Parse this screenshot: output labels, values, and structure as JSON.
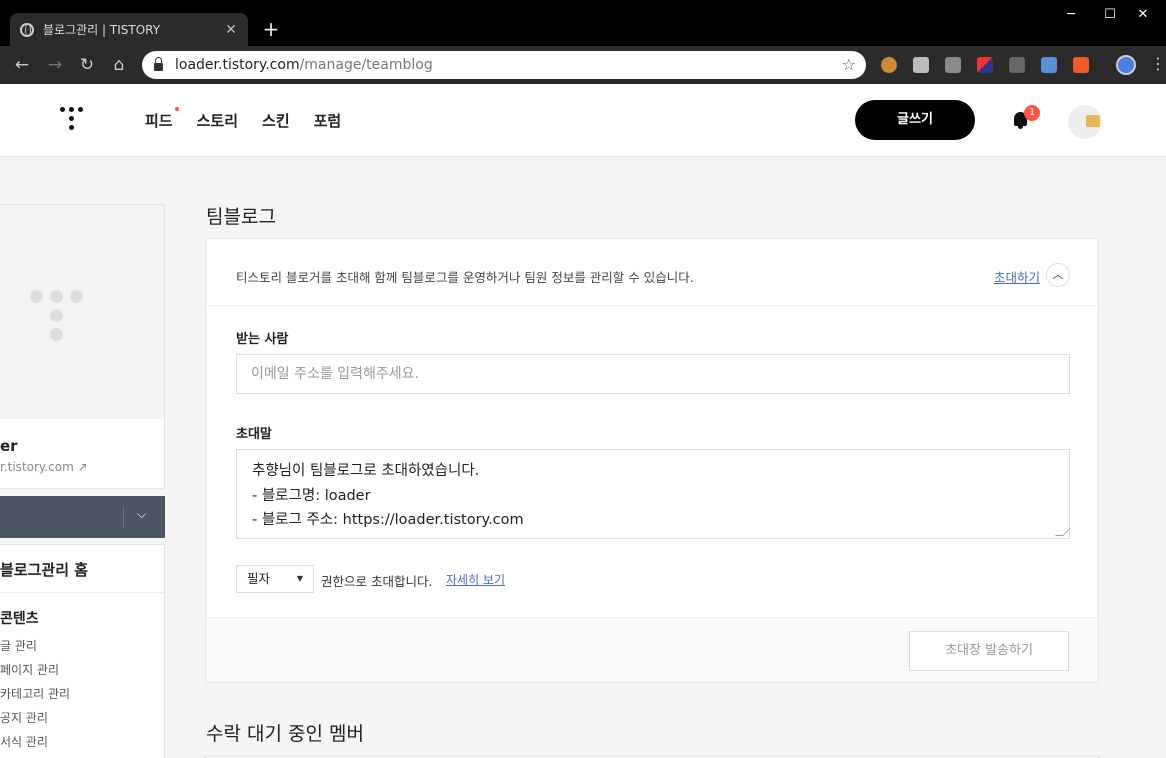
{
  "browser": {
    "tab_title": "블로그관리 | TISTORY",
    "new_tab": "+",
    "window_controls": {
      "minimize": "─",
      "maximize": "☐",
      "close": "✕"
    },
    "url_host": "loader.tistory.com",
    "url_path": "/manage/teamblog"
  },
  "header": {
    "nav": [
      "피드",
      "스토리",
      "스킨",
      "포럼"
    ],
    "write_button": "글쓰기",
    "notification_count": "1"
  },
  "sidebar": {
    "blog_name": "er",
    "blog_url": "r.tistory.com",
    "home": "블로그관리 홈",
    "section": "콘텐츠",
    "items": [
      "글 관리",
      "페이지 관리",
      "카테고리 관리",
      "공지 관리",
      "서식 관리"
    ]
  },
  "main": {
    "title": "팀블로그",
    "description": "티스토리 블로거를 초대해 함께 팀블로그를 운영하거나 팀원 정보를 관리할 수 있습니다.",
    "invite_link": "초대하기",
    "recipient_label": "받는 사람",
    "recipient_placeholder": "이메일 주소를 입력해주세요.",
    "message_label": "초대말",
    "message_lines": [
      "추향님이 팀블로그로 초대하였습니다.",
      "- 블로그명: loader",
      "- 블로그 주소: https://loader.tistory.com"
    ],
    "role_value": "필자",
    "role_text": "권한으로 초대합니다.",
    "detail_link": "자세히 보기",
    "send_button": "초대장 발송하기",
    "pending_title": "수락 대기 중인 멤버"
  }
}
